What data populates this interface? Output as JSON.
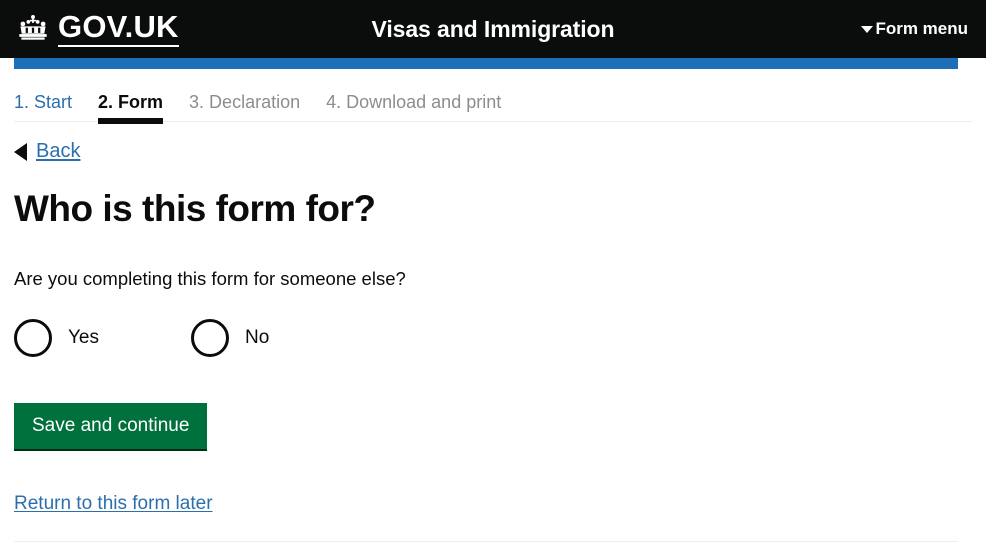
{
  "header": {
    "logo_text": "GOV.UK",
    "logo_icon": "gov-uk-crown-icon",
    "title": "Visas and Immigration",
    "form_menu_label": "Form menu",
    "form_menu_icon": "chevron-down-icon",
    "background_color": "#0b0c0c",
    "text_color": "#ffffff"
  },
  "accent_bar": {
    "color": "#1d70b8"
  },
  "step_nav": {
    "steps": [
      {
        "label": "1. Start",
        "state": "link"
      },
      {
        "label": "2. Form",
        "state": "active"
      },
      {
        "label": "3. Declaration",
        "state": "muted"
      },
      {
        "label": "4. Download and print",
        "state": "muted"
      }
    ]
  },
  "back": {
    "label": "Back",
    "icon": "triangle-left-icon"
  },
  "main": {
    "heading": "Who is this form for?",
    "question": "Are you completing this form for someone else?",
    "radio_options": [
      {
        "label": "Yes",
        "selected": false
      },
      {
        "label": "No",
        "selected": false
      }
    ],
    "save_button_label": "Save and continue",
    "save_button_color": "#00703c",
    "return_link_label": "Return to this form later"
  },
  "colors": {
    "link": "#2b6fad",
    "muted_text": "#8d8d8d",
    "body_text": "#0b0c0c"
  }
}
